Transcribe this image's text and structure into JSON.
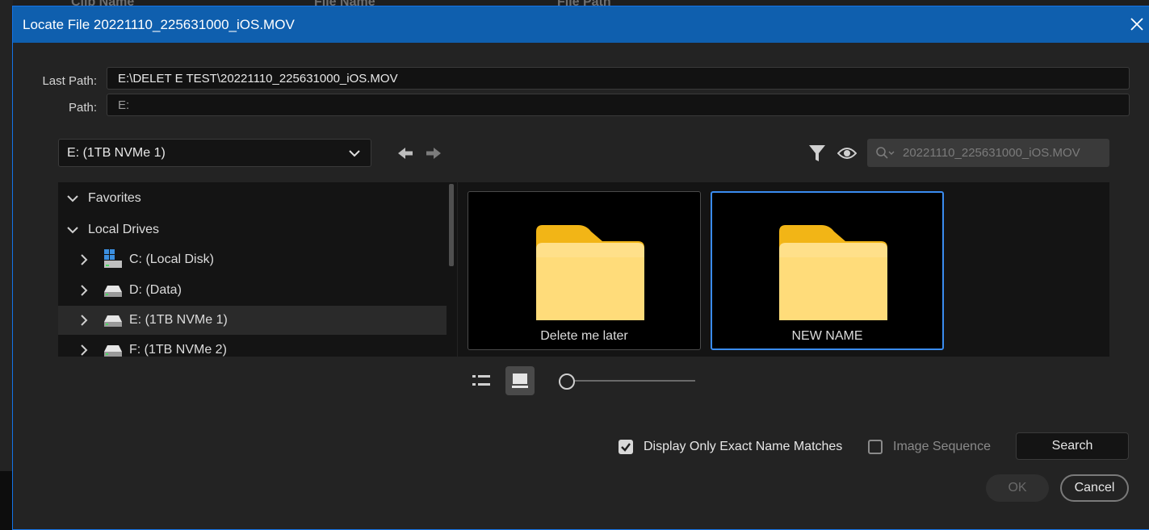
{
  "background_app": {
    "columns": [
      "Clip Name",
      "File Name",
      "File Path"
    ]
  },
  "dialog": {
    "title": "Locate File 20221110_225631000_iOS.MOV",
    "close_icon": "close-icon",
    "accent_color": "#0f5fae",
    "last_path_label": "Last Path:",
    "last_path_value": "E:\\DELET E TEST\\20221110_225631000_iOS.MOV",
    "path_label": "Path:",
    "path_value": "E:",
    "drive_selector": {
      "selected": "E: (1TB NVMe 1)",
      "icon": "chevron-down-icon"
    },
    "nav": {
      "back_icon": "arrow-left-icon",
      "forward_icon": "arrow-right-icon"
    },
    "toolbar": {
      "filter_icon": "filter-icon",
      "view_icon": "eye-icon",
      "search_placeholder": "20221110_225631000_iOS.MOV"
    },
    "tree": {
      "sections": [
        {
          "label": "Favorites",
          "expanded": true
        },
        {
          "label": "Local Drives",
          "expanded": true
        }
      ],
      "drives": [
        {
          "label": "C: (Local Disk)",
          "icon": "windows-drive-icon",
          "selected": false
        },
        {
          "label": "D: (Data)",
          "icon": "hard-drive-icon",
          "selected": false
        },
        {
          "label": "E: (1TB NVMe 1)",
          "icon": "hard-drive-icon",
          "selected": true
        },
        {
          "label": "F: (1TB NVMe 2)",
          "icon": "hard-drive-icon",
          "selected": false
        }
      ]
    },
    "folders": [
      {
        "name": "Delete me later",
        "icon": "folder-icon",
        "selected": false
      },
      {
        "name": "NEW NAME",
        "icon": "folder-icon",
        "selected": true
      }
    ],
    "view_controls": {
      "list_view_icon": "list-view-icon",
      "icon_view_icon": "icon-view-icon",
      "active_view": "icon",
      "thumbnail_size_fraction": 0.0
    },
    "options": {
      "exact_match_label": "Display Only Exact Name Matches",
      "exact_match_checked": true,
      "image_sequence_label": "Image Sequence",
      "image_sequence_checked": false
    },
    "buttons": {
      "search": "Search",
      "ok": "OK",
      "cancel": "Cancel"
    }
  }
}
